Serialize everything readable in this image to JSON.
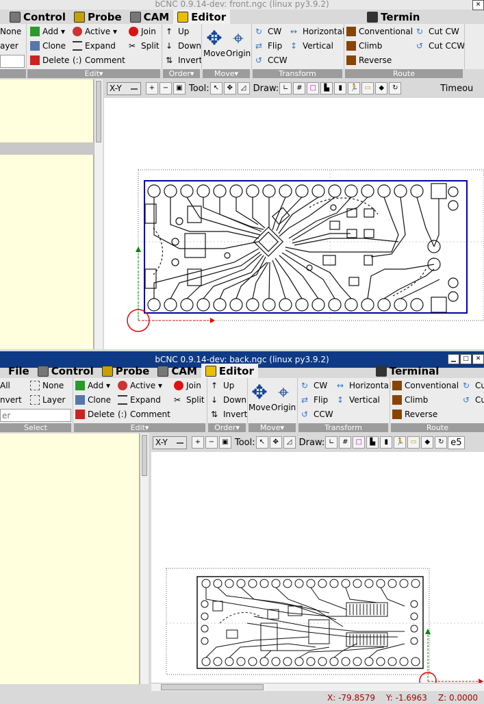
{
  "win1": {
    "title": "bCNC 0.9.14-dev: front.ngc (linux py3.9.2)",
    "tabs": [
      "Control",
      "Probe",
      "CAM",
      "Editor",
      "Termin"
    ],
    "select": {
      "none": "None",
      "layer": "ayer"
    },
    "edit": {
      "add": "Add",
      "clone": "Clone",
      "delete": "Delete",
      "active": "Active",
      "expand": "Expand",
      "comment": "Comment",
      "join": "Join",
      "split": "Split",
      "label": "Edit"
    },
    "order": {
      "up": "Up",
      "down": "Down",
      "invert": "Invert",
      "label": "Order"
    },
    "move": {
      "move": "Move",
      "origin": "Origin",
      "label": "Move"
    },
    "transform": {
      "cw": "CW",
      "flip": "Flip",
      "ccw": "CCW",
      "horizontal": "Horizontal",
      "vertical": "Vertical",
      "label": "Transform"
    },
    "route": {
      "conventional": "Conventional",
      "climb": "Climb",
      "reverse": "Reverse",
      "cutcw": "Cut CW",
      "cutccw": "Cut CCW",
      "label": "Route"
    },
    "toolbar": {
      "view": "X-Y",
      "tool": "Tool:",
      "draw": "Draw:",
      "timeout": "Timeou"
    }
  },
  "win2": {
    "title": "bCNC 0.9.14-dev: back.ngc (linux py3.9.2)",
    "tabs": [
      "File",
      "Control",
      "Probe",
      "CAM",
      "Editor",
      "Terminal"
    ],
    "select": {
      "all": "All",
      "invert": "nvert",
      "none": "None",
      "layer": "Layer",
      "filter": "er",
      "label": "Select"
    },
    "edit": {
      "add": "Add",
      "clone": "Clone",
      "delete": "Delete",
      "active": "Active",
      "expand": "Expand",
      "comment": "Comment",
      "join": "Join",
      "split": "Split",
      "label": "Edit"
    },
    "order": {
      "up": "Up",
      "down": "Down",
      "invert": "Invert",
      "label": "Order"
    },
    "move": {
      "move": "Move",
      "origin": "Origin",
      "label": "Move"
    },
    "transform": {
      "cw": "CW",
      "flip": "Flip",
      "ccw": "CCW",
      "horizontal": "Horizontal",
      "vertical": "Vertical",
      "label": "Transform"
    },
    "route": {
      "conventional": "Conventional",
      "climb": "Climb",
      "reverse": "Reverse",
      "cut1": "Cu",
      "cut2": "Cu",
      "label": "Route"
    },
    "toolbar": {
      "view": "X-Y",
      "tool": "Tool:",
      "draw": "Draw:",
      "extra": "e5"
    },
    "status": {
      "x": "X: -79.8579",
      "y": "Y: -1.6963",
      "z": "Z: 0.0000"
    }
  },
  "colors": {
    "title_active": "#0e3a86",
    "left_pane": "#ffffdd",
    "status_text": "#aa0000",
    "pcb_outline": "#0000aa"
  }
}
